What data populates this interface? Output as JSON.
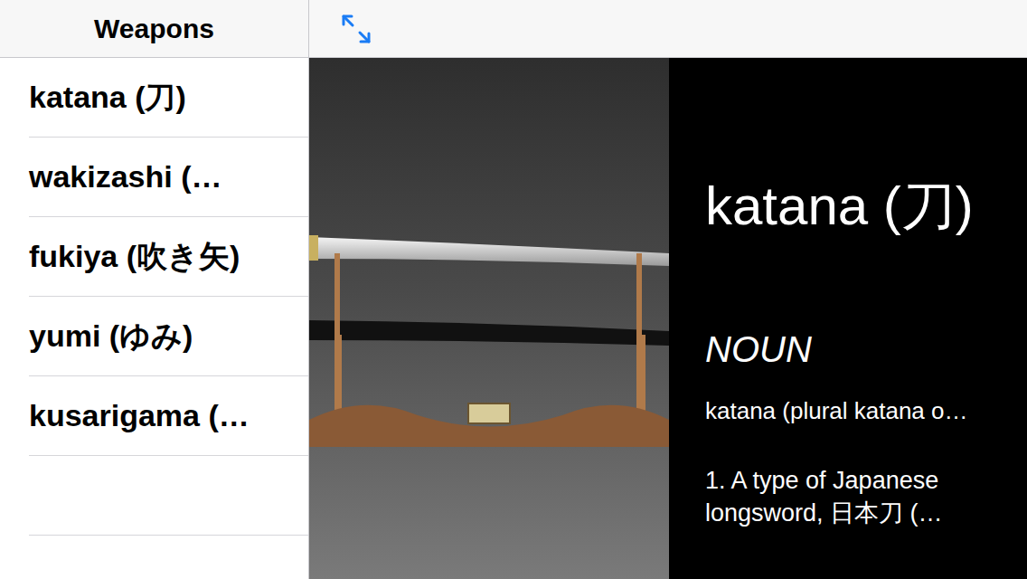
{
  "sidebar": {
    "title": "Weapons",
    "items": [
      "katana (刀)",
      "wakizashi (…",
      "fukiya (吹き矢)",
      "yumi (ゆみ)",
      "kusarigama (…"
    ]
  },
  "detail": {
    "title": "katana (刀)",
    "part_of_speech": "NOUN",
    "summary": "katana (plural katana o…",
    "definition": "1. A type of Japanese longsword, 日本刀 (…"
  }
}
